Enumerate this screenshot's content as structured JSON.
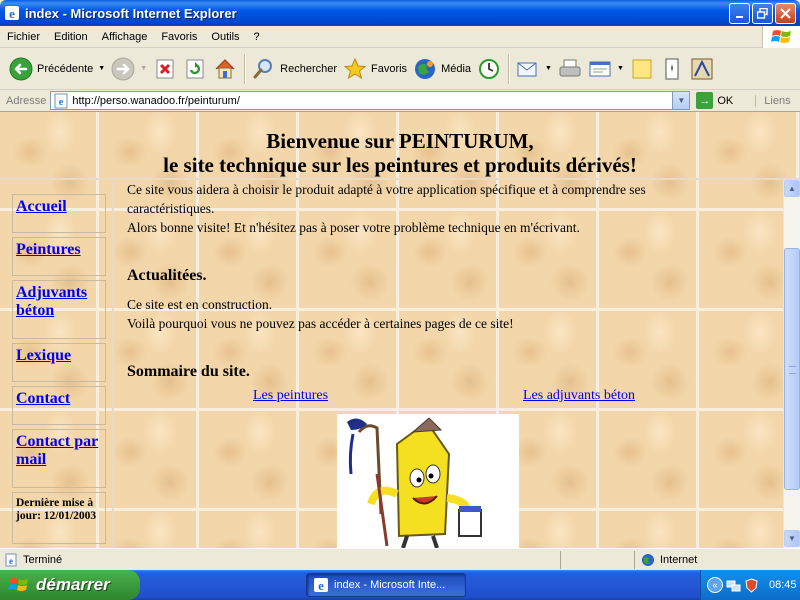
{
  "window": {
    "title": "index - Microsoft Internet Explorer"
  },
  "menu": [
    "Fichier",
    "Edition",
    "Affichage",
    "Favoris",
    "Outils",
    "?"
  ],
  "toolbar": {
    "back_label": "Précédente",
    "search_label": "Rechercher",
    "favorites_label": "Favoris",
    "media_label": "Média"
  },
  "address": {
    "label": "Adresse",
    "url": "http://perso.wanadoo.fr/peinturum/",
    "go_label": "OK",
    "links_label": "Liens"
  },
  "page": {
    "header": {
      "line1": "Bienvenue sur PEINTURUM,",
      "line2": "le site technique sur les peintures et produits dérivés!"
    },
    "nav": [
      {
        "label": "Accueil"
      },
      {
        "label": "Peintures"
      },
      {
        "label": "Adjuvants béton"
      },
      {
        "label": "Lexique"
      },
      {
        "label": "Contact"
      },
      {
        "label": "Contact par mail"
      }
    ],
    "last_update": "Dernière mise à jour: 12/01/2003",
    "intro_line1": "Ce site vous aidera à choisir le produit adapté à votre application spécifique et à comprendre ses",
    "intro_line2": "caractéristiques.",
    "intro_line3": "Alors bonne visite! Et n'hésitez pas à poser votre problème technique en m'écrivant.",
    "news_heading": "Actualitées.",
    "news_line1": "Ce site est en construction.",
    "news_line2": "Voilà pourquoi vous ne pouvez pas accéder à certaines pages de ce site!",
    "summary_heading": "Sommaire du site.",
    "summary_links": [
      "Les peintures",
      "Les adjuvants béton"
    ]
  },
  "status": {
    "text": "Terminé",
    "zone": "Internet"
  },
  "taskbar": {
    "start_label": "démarrer",
    "task_label": "index - Microsoft Inte...",
    "clock": "08:45"
  },
  "colors": {
    "link": "#0000EE",
    "titlebar": "#0058E6",
    "start": "#3C9B3C",
    "page_bg": "#F3D7AA"
  },
  "icons": {
    "app": "ie-icon",
    "back": "back-arrow-icon",
    "forward": "forward-arrow-icon",
    "stop": "stop-icon",
    "refresh": "refresh-icon",
    "home": "home-icon",
    "search": "search-icon",
    "favorites": "star-icon",
    "media": "media-icon",
    "history": "history-icon",
    "mail": "mail-icon",
    "print": "print-icon",
    "edit": "edit-icon",
    "discuss": "note-icon",
    "messenger": "messenger-icon",
    "research": "research-icon"
  }
}
